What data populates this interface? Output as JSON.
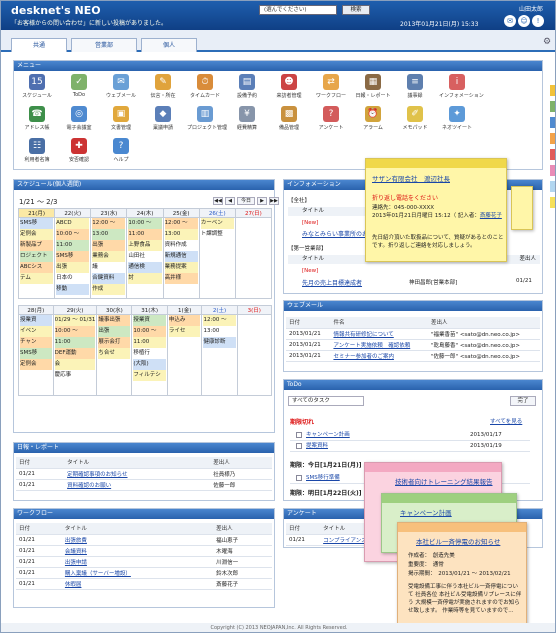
{
  "header": {
    "logo": "desknet's NEO",
    "notice": "「お客様からの問い合わせ」に新しい投稿がありました。",
    "search_select": "(選んでください)",
    "search_button": "検索",
    "datetime": "2013年01月21日(月) 15:33",
    "user": "山田太郎"
  },
  "tabs": [
    "共通",
    "営業部",
    "個人"
  ],
  "menu": {
    "title": "メニュー",
    "items": [
      {
        "label": "スケジュール",
        "icon": "calendar-icon",
        "color": "#4f6fb0",
        "glyph": "15"
      },
      {
        "label": "ToDo",
        "icon": "todo-icon",
        "color": "#7fb26a",
        "glyph": "✓"
      },
      {
        "label": "ウェブメール",
        "icon": "mail-icon",
        "color": "#6aa0d6",
        "glyph": "✉"
      },
      {
        "label": "伝言・所在",
        "icon": "message-icon",
        "color": "#e0a33c",
        "glyph": "✎"
      },
      {
        "label": "タイムカード",
        "icon": "timecard-icon",
        "color": "#d98c3a",
        "glyph": "⏱"
      },
      {
        "label": "設備予約",
        "icon": "facility-icon",
        "color": "#5b7fb8",
        "glyph": "▤"
      },
      {
        "label": "来訪者管理",
        "icon": "visitor-icon",
        "color": "#c44",
        "glyph": "☻"
      },
      {
        "label": "ワークフロー",
        "icon": "workflow-icon",
        "color": "#e7a64a",
        "glyph": "⇄"
      },
      {
        "label": "日報・レポート",
        "icon": "report-icon",
        "color": "#8a6a45",
        "glyph": "▦"
      },
      {
        "label": "議事録",
        "icon": "minutes-icon",
        "color": "#5e7fae",
        "glyph": "≡"
      },
      {
        "label": "インフォメーション",
        "icon": "info-icon",
        "color": "#d86060",
        "glyph": "i"
      },
      {
        "label": "アドレス帳",
        "icon": "address-icon",
        "color": "#3e8f4a",
        "glyph": "☎"
      },
      {
        "label": "電子会議室",
        "icon": "forum-icon",
        "color": "#4f8ad0",
        "glyph": "◎"
      },
      {
        "label": "文書管理",
        "icon": "document-icon",
        "color": "#e1a83c",
        "glyph": "▣"
      },
      {
        "label": "稟議申請",
        "icon": "approval-icon",
        "color": "#5b7fb8",
        "glyph": "◆"
      },
      {
        "label": "プロジェクト管理",
        "icon": "project-icon",
        "color": "#6a9bd2",
        "glyph": "▥"
      },
      {
        "label": "経費精算",
        "icon": "expense-icon",
        "color": "#8795aa",
        "glyph": "¥"
      },
      {
        "label": "備品管理",
        "icon": "equipment-icon",
        "color": "#c9913e",
        "glyph": "▩"
      },
      {
        "label": "アンケート",
        "icon": "survey-icon",
        "color": "#d35b5b",
        "glyph": "?"
      },
      {
        "label": "アラーム",
        "icon": "alarm-icon",
        "color": "#d2a43c",
        "glyph": "⏰"
      },
      {
        "label": "メモパッド",
        "icon": "memo-icon",
        "color": "#e0c24a",
        "glyph": "✐"
      },
      {
        "label": "ネオツイート",
        "icon": "tweet-icon",
        "color": "#5d9ad8",
        "glyph": "✦"
      },
      {
        "label": "利用者名簿",
        "icon": "userlist-icon",
        "color": "#4a6fa5",
        "glyph": "☷"
      },
      {
        "label": "安否確認",
        "icon": "safety-icon",
        "color": "#c33",
        "glyph": "✚"
      },
      {
        "label": "ヘルプ",
        "icon": "help-icon",
        "color": "#4a88d0",
        "glyph": "?"
      }
    ]
  },
  "schedule": {
    "title": "スケジュール(個人週間)",
    "range": "1/21 ～ 2/3",
    "nav": [
      "◀◀",
      "◀",
      "今日",
      "▶",
      "▶▶"
    ],
    "week1_days": [
      "21(月)",
      "22(火)",
      "23(水)",
      "24(木)",
      "25(金)",
      "26(土)",
      "27(日)"
    ],
    "week1_events": [
      [
        "SMS移",
        "定例会",
        "新製品プ",
        "ロジェクト",
        "ABCシス",
        "テム"
      ],
      [
        "ABCD",
        "10:00 ～",
        "11:00",
        "SMS移",
        "出張",
        "日本の",
        "移動"
      ],
      [
        "12:00 ～",
        "13:00",
        "出張",
        "業務会",
        "議",
        "合鍵資料",
        "作成"
      ],
      [
        "10:00 ～",
        "11:00",
        "上野食品",
        "山田社",
        "通信検",
        "討"
      ],
      [
        "12:00 ～",
        "13:00",
        "資料作成",
        "新規通信",
        "業務提案",
        "高井様"
      ],
      [
        "カーベン",
        "ト課調整"
      ],
      []
    ],
    "week2_days": [
      "28(月)",
      "29(火)",
      "30(水)",
      "31(木)",
      "1(金)",
      "2(土)",
      "3(日)"
    ],
    "week2_events": [
      [
        "授業資",
        "イベン",
        "チャン",
        "SMS移",
        "定例会"
      ],
      [
        "01/29 ～ 01/31",
        "10:00 ～",
        "11:00",
        "DEF運動",
        "会",
        "慶応事"
      ],
      [
        "議事出張",
        "出張",
        "展示会打",
        "ち合せ"
      ],
      [
        "授業資",
        "10:00 ～",
        "11:00",
        "移植行",
        "(大阪)",
        "フィルテシ"
      ],
      [
        "申込み",
        "ライセ"
      ],
      [
        "12:00 ～",
        "13:00",
        "健康診断"
      ],
      []
    ]
  },
  "reports": {
    "title": "日報・レポート",
    "cols": [
      "日付",
      "タイトル",
      "差出人"
    ],
    "rows": [
      [
        "01/21",
        "定期確認事項のお知らせ",
        "社員様乃"
      ],
      [
        "01/21",
        "資料確認のお願い",
        "佐藤一郎"
      ]
    ]
  },
  "workflow": {
    "title": "ワークフロー",
    "cols": [
      "日付",
      "タイトル",
      "差出人"
    ],
    "rows": [
      [
        "01/21",
        "出張旅費",
        "福山恵子"
      ],
      [
        "01/21",
        "会議資料",
        "木曜海"
      ],
      [
        "01/21",
        "出張申請",
        "川淵信一"
      ],
      [
        "01/21",
        "購入稟議（サーバー増設）",
        "鈴木次郎"
      ],
      [
        "01/21",
        "休暇届",
        "斎藤花子"
      ]
    ]
  },
  "information": {
    "title": "インフォメーション",
    "section1": "【全社】",
    "col_title": "タイトル",
    "new1": "[New]",
    "item1": "みなとみらい事業所のお知",
    "section2": "【第一営業部】",
    "new2": "[New]",
    "item2": "先月の売上目標達成者",
    "item2_from": "神田昌郎[営業本部]",
    "item2_date": "01/21",
    "col_from": "差出人"
  },
  "webmail": {
    "title": "ウェブメール",
    "cols": [
      "日付",
      "件名",
      "差出人"
    ],
    "rows": [
      [
        "2013/01/21",
        "情報共有研修記について",
        "\"福業香苗\" <sato@dn.neo.co.jp>"
      ],
      [
        "2013/01/21",
        "アンケート実施依頼　確認依頼",
        "\"乾島藤香\" <sato@dn.neo.co.jp>"
      ],
      [
        "2013/01/21",
        "セミナー参加者のご案内",
        "\"佐藤一郎\" <sato@dn.neo.co.jp>"
      ]
    ]
  },
  "todo": {
    "title": "ToDo",
    "filter": "すべてのタスク",
    "done_button": "完了",
    "overdue": "期限切れ",
    "see_all": "すべてを見る",
    "items_overdue": [
      [
        "キャンペーン計画",
        "2013/01/17"
      ],
      [
        "提案資料",
        "2013/01/19"
      ]
    ],
    "today": "期限：今日[1月21日(月)]",
    "items_today": [
      [
        "SMS移行準備",
        "2013/01/21"
      ]
    ],
    "tomorrow": "期限：明日[1月22日(火)]"
  },
  "survey": {
    "title": "アンケート",
    "cols": [
      "日付",
      "タイトル"
    ],
    "rows": [
      [
        "01/21",
        "コンプライアンス調"
      ]
    ]
  },
  "sticky_call": {
    "company": "サザン有限会社　渡辺社長",
    "title": "折り返し電話をください",
    "tel": "連絡先：045-000-XXXX",
    "time": "2013年01月21日月曜日 15:12（ 記入者：",
    "writer": "斎藤花子",
    "body": "先日紹介頂いた取扱品について、質疑があるとのことです。折り返しご連絡を対応しましょう。"
  },
  "sticky_training": {
    "title": "技術者向けトレーニング結果報告"
  },
  "sticky_campaign": {
    "title": "キャンペーン計画"
  },
  "sticky_news": {
    "title": "本社ビル一斉停電のお知らせ",
    "author": "作成者：　創造先美",
    "importance": "重要度：　通常",
    "period": "掲示期間：　2013/01/21 ～ 2013/02/21",
    "body": "受電設備工事に伴う本社ビル一斉停電について 社員各位 本社ビル受電設備リプレースに伴う 大規模一斉停電が実施されますのでお知らせ致します。 作業時等を見ていますので..."
  },
  "footer": "Copyright (C) 2013 NEOJAPAN,Inc. All Rights Reserved."
}
